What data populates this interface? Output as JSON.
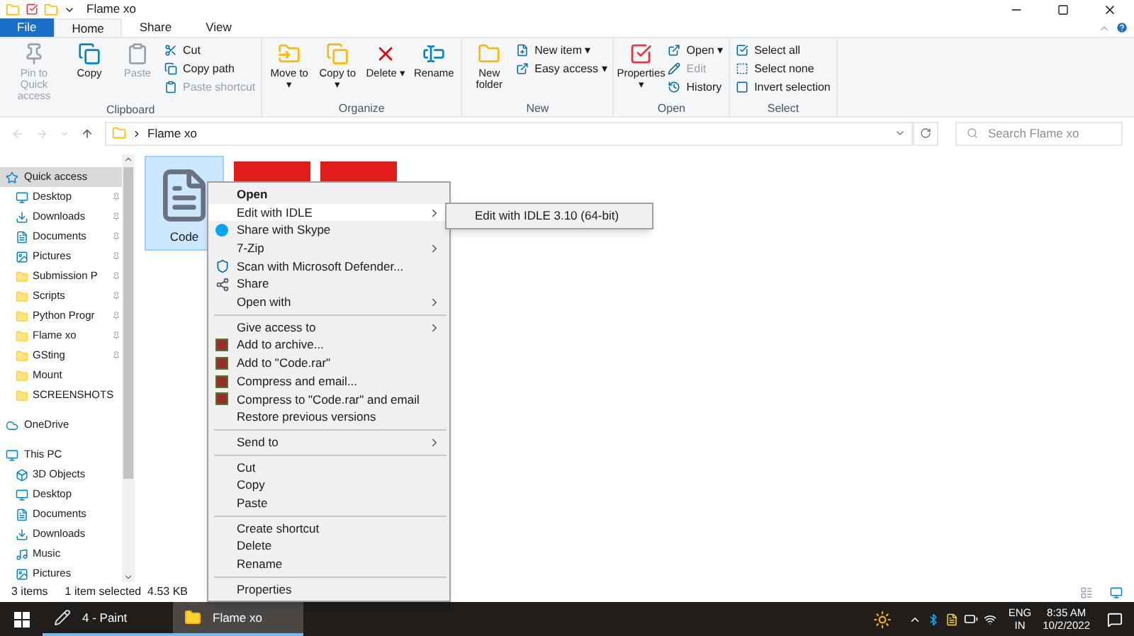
{
  "window": {
    "title": "Flame xo"
  },
  "ribbon_tabs": [
    {
      "label": "File",
      "kind": "file",
      "selected": false
    },
    {
      "label": "Home",
      "kind": "tab",
      "selected": true
    },
    {
      "label": "Share",
      "kind": "tab",
      "selected": false
    },
    {
      "label": "View",
      "kind": "tab",
      "selected": false
    }
  ],
  "ribbon_groups": [
    {
      "label": "Clipboard",
      "large": [
        {
          "label": "Pin to Quick access",
          "disabled": true
        },
        {
          "label": "Copy",
          "disabled": false
        },
        {
          "label": "Paste",
          "disabled": true
        }
      ],
      "small": [
        {
          "label": "Cut",
          "disabled": false
        },
        {
          "label": "Copy path",
          "disabled": false
        },
        {
          "label": "Paste shortcut",
          "disabled": true
        }
      ]
    },
    {
      "label": "Organize",
      "large": [
        {
          "label": "Move to ▾",
          "disabled": false
        },
        {
          "label": "Copy to ▾",
          "disabled": false
        },
        {
          "label": "Delete ▾",
          "disabled": false
        },
        {
          "label": "Rename",
          "disabled": false
        }
      ]
    },
    {
      "label": "New",
      "large": [
        {
          "label": "New folder",
          "disabled": false
        }
      ],
      "small": [
        {
          "label": "New item ▾",
          "disabled": false
        },
        {
          "label": "Easy access ▾",
          "disabled": false
        }
      ]
    },
    {
      "label": "Open",
      "large": [
        {
          "label": "Properties ▾",
          "disabled": false
        }
      ],
      "small": [
        {
          "label": "Open ▾",
          "disabled": false
        },
        {
          "label": "Edit",
          "disabled": true
        },
        {
          "label": "History",
          "disabled": false
        }
      ]
    },
    {
      "label": "Select",
      "small": [
        {
          "label": "Select all",
          "disabled": false
        },
        {
          "label": "Select none",
          "disabled": false
        },
        {
          "label": "Invert selection",
          "disabled": false
        }
      ]
    }
  ],
  "address": {
    "path": "Flame xo"
  },
  "search": {
    "placeholder": "Search Flame xo"
  },
  "sidebar": {
    "items": [
      {
        "label": "Quick access",
        "selected": true,
        "children": [
          {
            "label": "Desktop",
            "selected": false,
            "pinned": true
          },
          {
            "label": "Downloads",
            "selected": false,
            "pinned": true
          },
          {
            "label": "Documents",
            "selected": false,
            "pinned": true
          },
          {
            "label": "Pictures",
            "selected": false,
            "pinned": true
          },
          {
            "label": "Submission P",
            "selected": false,
            "pinned": true
          },
          {
            "label": "Scripts",
            "selected": false,
            "pinned": true
          },
          {
            "label": "Python Progr",
            "selected": false,
            "pinned": true
          },
          {
            "label": "Flame xo",
            "selected": false,
            "pinned": true
          },
          {
            "label": "GSting",
            "selected": false,
            "pinned": true
          },
          {
            "label": "Mount",
            "selected": false,
            "pinned": false
          },
          {
            "label": "SCREENSHOTS",
            "selected": false,
            "pinned": false
          }
        ]
      },
      {
        "label": "OneDrive",
        "selected": false
      },
      {
        "label": "This PC",
        "selected": false,
        "children": [
          {
            "label": "3D Objects",
            "selected": false,
            "pinned": false
          },
          {
            "label": "Desktop",
            "selected": false,
            "pinned": false
          },
          {
            "label": "Documents",
            "selected": false,
            "pinned": false
          },
          {
            "label": "Downloads",
            "selected": false,
            "pinned": false
          },
          {
            "label": "Music",
            "selected": false,
            "pinned": false
          },
          {
            "label": "Pictures",
            "selected": false,
            "pinned": false
          }
        ]
      }
    ]
  },
  "files": [
    {
      "name": "Code",
      "kind": "python",
      "selected": true
    },
    {
      "kind": "image",
      "selected": false
    },
    {
      "kind": "image",
      "selected": false
    }
  ],
  "context_menu": {
    "items": [
      {
        "kind": "item",
        "label": "Open",
        "bold": true,
        "submenu": false,
        "selected": false
      },
      {
        "kind": "item",
        "label": "Edit with IDLE",
        "bold": false,
        "submenu": true,
        "selected": true
      },
      {
        "kind": "item",
        "label": "Share with Skype",
        "bold": false,
        "submenu": false,
        "selected": false
      },
      {
        "kind": "item",
        "label": "7-Zip",
        "bold": false,
        "submenu": true,
        "selected": false
      },
      {
        "kind": "item",
        "label": "Scan with Microsoft Defender...",
        "bold": false,
        "submenu": false,
        "selected": false
      },
      {
        "kind": "item",
        "label": "Share",
        "bold": false,
        "submenu": false,
        "selected": false
      },
      {
        "kind": "item",
        "label": "Open with",
        "bold": false,
        "submenu": true,
        "selected": false
      },
      {
        "kind": "separator"
      },
      {
        "kind": "item",
        "label": "Give access to",
        "bold": false,
        "submenu": true,
        "selected": false
      },
      {
        "kind": "item",
        "label": "Add to archive...",
        "bold": false,
        "submenu": false,
        "selected": false
      },
      {
        "kind": "item",
        "label": "Add to \"Code.rar\"",
        "bold": false,
        "submenu": false,
        "selected": false
      },
      {
        "kind": "item",
        "label": "Compress and email...",
        "bold": false,
        "submenu": false,
        "selected": false
      },
      {
        "kind": "item",
        "label": "Compress to \"Code.rar\" and email",
        "bold": false,
        "submenu": false,
        "selected": false
      },
      {
        "kind": "item",
        "label": "Restore previous versions",
        "bold": false,
        "submenu": false,
        "selected": false
      },
      {
        "kind": "separator"
      },
      {
        "kind": "item",
        "label": "Send to",
        "bold": false,
        "submenu": true,
        "selected": false
      },
      {
        "kind": "separator"
      },
      {
        "kind": "item",
        "label": "Cut",
        "bold": false,
        "submenu": false,
        "selected": false
      },
      {
        "kind": "item",
        "label": "Copy",
        "bold": false,
        "submenu": false,
        "selected": false
      },
      {
        "kind": "item",
        "label": "Paste",
        "bold": false,
        "submenu": false,
        "selected": false
      },
      {
        "kind": "separator"
      },
      {
        "kind": "item",
        "label": "Create shortcut",
        "bold": false,
        "submenu": false,
        "selected": false
      },
      {
        "kind": "item",
        "label": "Delete",
        "bold": false,
        "submenu": false,
        "selected": false
      },
      {
        "kind": "item",
        "label": "Rename",
        "bold": false,
        "submenu": false,
        "selected": false
      },
      {
        "kind": "separator"
      },
      {
        "kind": "item",
        "label": "Properties",
        "bold": false,
        "submenu": false,
        "selected": false
      }
    ]
  },
  "submenu": {
    "items": [
      {
        "label": "Edit with IDLE 3.10 (64-bit)"
      }
    ]
  },
  "status_bar": {
    "count": "3 items",
    "selection": "1 item selected  4.53 KB"
  },
  "taskbar": {
    "apps": [
      {
        "label": "4 - Paint",
        "selected": false
      },
      {
        "label": "Flame xo",
        "selected": true
      }
    ],
    "language": "ENG",
    "region": "IN",
    "time": "8:35 AM",
    "date": "10/2/2022"
  }
}
